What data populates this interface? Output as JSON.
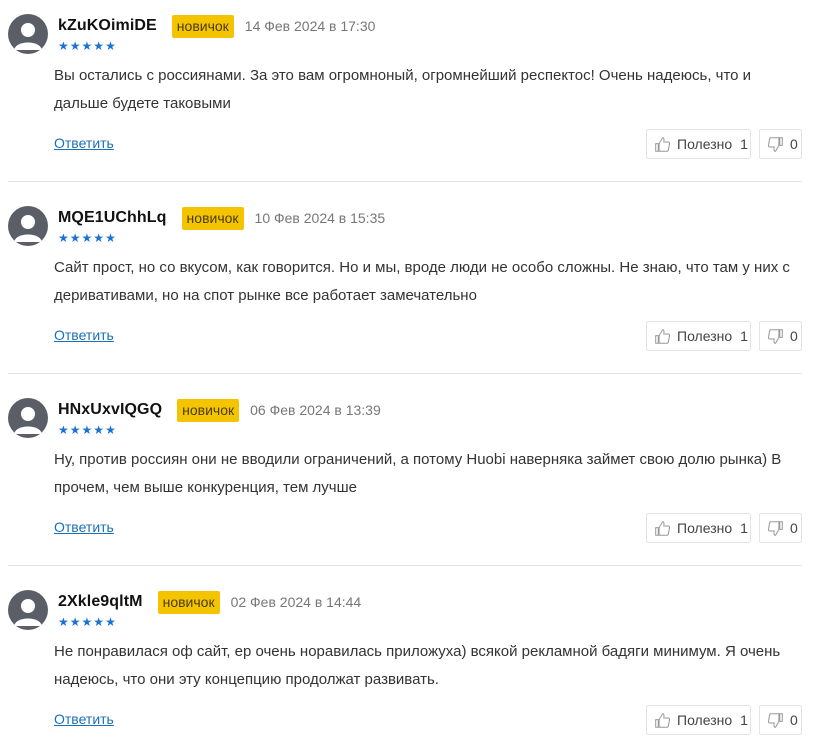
{
  "colors": {
    "badge": "#f5c400",
    "stars": "#1a73d1",
    "link": "#1a6fb8",
    "avatar": "#5a5e66"
  },
  "icons": {
    "avatar": "user-silhouette-icon",
    "like": "thumbs-up-icon",
    "dislike": "thumbs-down-icon",
    "star": "star-icon"
  },
  "reviews": [
    {
      "username": "kZuKOimiDE",
      "badge": "новичок",
      "date": "14 Фев 2024 в 17:30",
      "rating": 5,
      "text": "Вы остались с россиянами. За это вам огромноный, огромнейший респектос! Очень надеюсь, что и дальше будете таковыми",
      "reply_label": "Ответить",
      "useful_label": "Полезно",
      "useful_count": "1",
      "useless_count": "0"
    },
    {
      "username": "MQE1UChhLq",
      "badge": "новичок",
      "date": "10 Фев 2024 в 15:35",
      "rating": 5,
      "text": "Сайт прост, но со вкусом, как говорится. Но и мы, вроде люди не особо сложны. Не знаю, что там у них с деривативами, но на спот рынке все работает замечательно",
      "reply_label": "Ответить",
      "useful_label": "Полезно",
      "useful_count": "1",
      "useless_count": "0"
    },
    {
      "username": "HNxUxvIQGQ",
      "badge": "новичок",
      "date": "06 Фев 2024 в 13:39",
      "rating": 5,
      "text": "Ну, против россиян они не вводили ограничений, а потому Huobi наверняка займет свою долю рынка) В прочем, чем выше конкуренция, тем лучше",
      "reply_label": "Ответить",
      "useful_label": "Полезно",
      "useful_count": "1",
      "useless_count": "0"
    },
    {
      "username": "2Xkle9qltM",
      "badge": "новичок",
      "date": "02 Фев 2024 в 14:44",
      "rating": 5,
      "text": "Не понравилася оф сайт, ер очень норавилась приложуха) всякой рекламной бадяги минимум. Я очень надеюсь, что они эту концепцию продолжат развивать.",
      "reply_label": "Ответить",
      "useful_label": "Полезно",
      "useful_count": "1",
      "useless_count": "0"
    }
  ]
}
